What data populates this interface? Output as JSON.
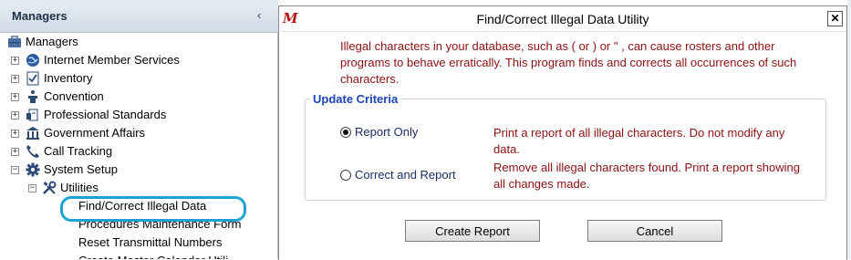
{
  "left_panel": {
    "title": "Managers",
    "collapse_glyph": "‹",
    "tree": [
      {
        "label": "Managers",
        "icon": "managers-icon",
        "expander": "",
        "indent": 0
      },
      {
        "label": "Internet Member Services",
        "icon": "globe-icon",
        "expander": "+",
        "indent": 1
      },
      {
        "label": "Inventory",
        "icon": "checklist-icon",
        "expander": "+",
        "indent": 1
      },
      {
        "label": "Convention",
        "icon": "podium-icon",
        "expander": "+",
        "indent": 1
      },
      {
        "label": "Professional Standards",
        "icon": "document-icon",
        "expander": "+",
        "indent": 1
      },
      {
        "label": "Government Affairs",
        "icon": "capitol-icon",
        "expander": "+",
        "indent": 1
      },
      {
        "label": "Call Tracking",
        "icon": "phone-icon",
        "expander": "+",
        "indent": 1
      },
      {
        "label": "System Setup",
        "icon": "gear-icon",
        "expander": "−",
        "indent": 1
      },
      {
        "label": "Utilities",
        "icon": "tools-icon",
        "expander": "−",
        "indent": 2
      },
      {
        "label": "Find/Correct Illegal Data",
        "icon": "",
        "expander": "",
        "indent": 3
      },
      {
        "label": "Procedures Maintenance Form",
        "icon": "",
        "expander": "",
        "indent": 3
      },
      {
        "label": "Reset Transmittal Numbers",
        "icon": "",
        "expander": "",
        "indent": 3
      },
      {
        "label": "Create Master Calendar Utili",
        "icon": "",
        "expander": "",
        "indent": 3
      }
    ],
    "highlight_color": "#1aa2d4"
  },
  "dialog": {
    "logo_text": "M",
    "title": "Find/Correct Illegal Data Utility",
    "close_label": "✕",
    "warning_text": "Illegal characters in your database, such as ( or ) or \" , can cause rosters and other programs to behave erratically. This program finds and corrects all occurrences of such characters.",
    "criteria_title": "Update Criteria",
    "options": [
      {
        "label": "Report Only",
        "selected": true,
        "description": "Print a report of all illegal characters.  Do not modify any data."
      },
      {
        "label": "Correct and Report",
        "selected": false,
        "description": "Remove all illegal characters found.  Print a report showing all changes made."
      }
    ],
    "buttons": {
      "create_report": "Create Report",
      "cancel": "Cancel"
    },
    "colors": {
      "warning": "#8b1010",
      "legend": "#1c44b4",
      "logo": "#b01313"
    }
  }
}
